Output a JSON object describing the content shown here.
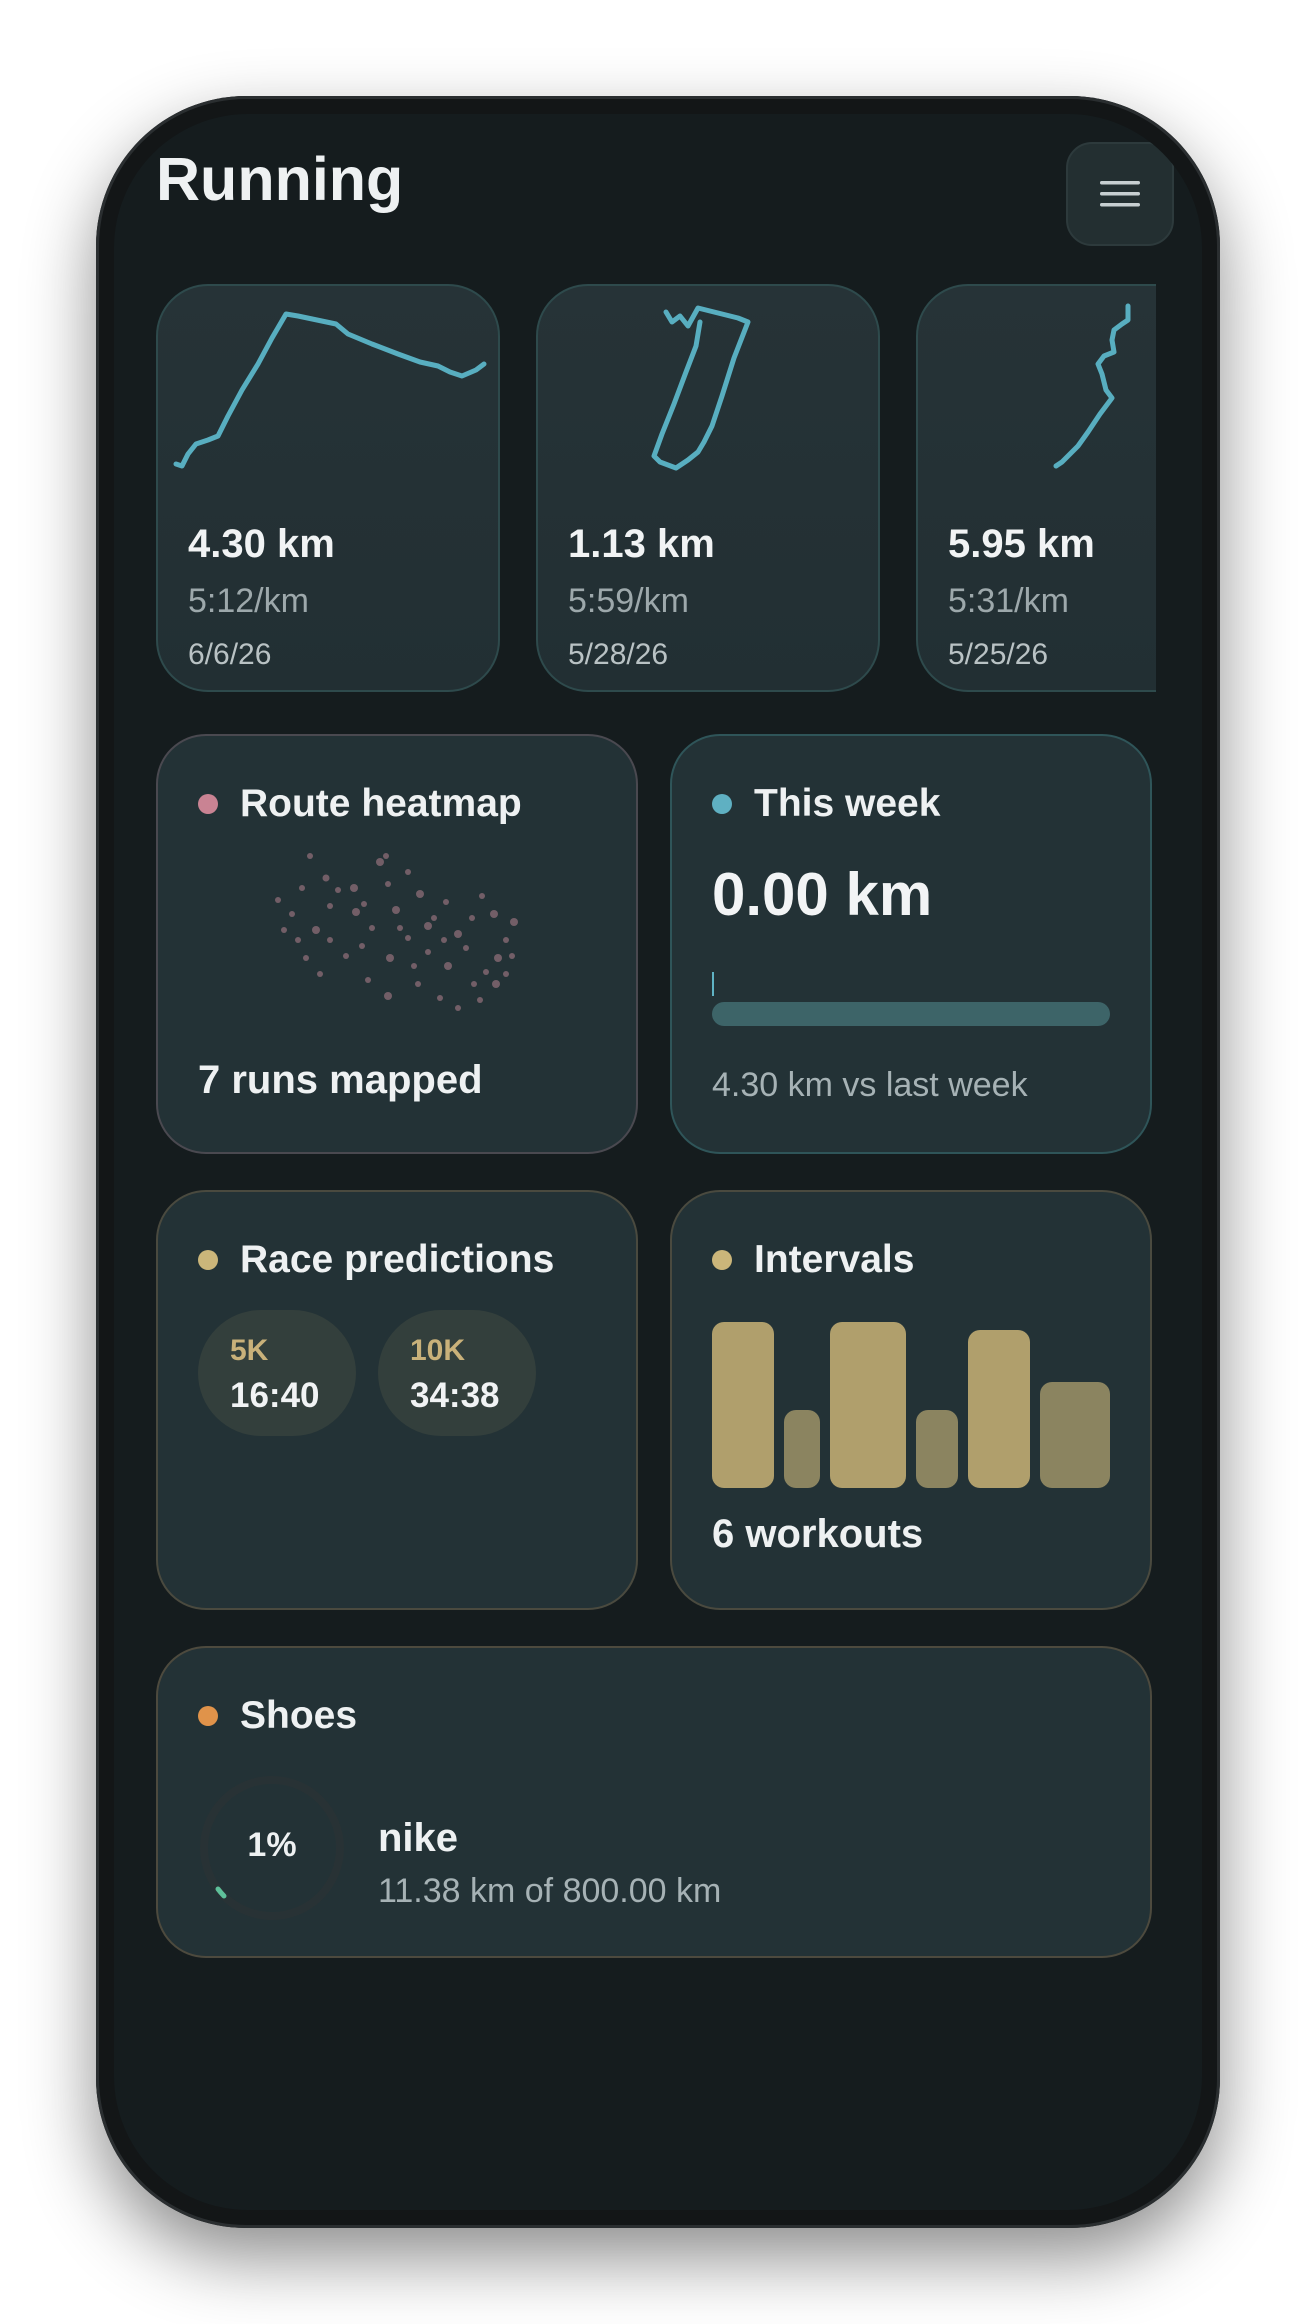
{
  "app": {
    "title": "Running"
  },
  "header": {
    "menu_icon": "hamburger-menu-icon"
  },
  "recent_runs": [
    {
      "distance": "4.30 km",
      "pace": "5:12/km",
      "date": "6/6/26"
    },
    {
      "distance": "1.13 km",
      "pace": "5:59/km",
      "date": "5/28/26"
    },
    {
      "distance": "5.95 km",
      "pace": "5:31/km",
      "date": "5/25/26"
    }
  ],
  "heatmap": {
    "title": "Route heatmap",
    "footer": "7 runs mapped",
    "dot_color": "#c98393"
  },
  "this_week": {
    "title": "This week",
    "value": "0.00 km",
    "compare": "4.30 km vs last week",
    "progress": 0.0,
    "dot_color": "#5fb0c2"
  },
  "race_predictions": {
    "title": "Race predictions",
    "dot_color": "#cbb67a",
    "items": [
      {
        "distance": "5K",
        "time": "16:40"
      },
      {
        "distance": "10K",
        "time": "34:38"
      }
    ]
  },
  "intervals": {
    "title": "Intervals",
    "footer": "6 workouts",
    "dot_color": "#cbb67a"
  },
  "shoes": {
    "title": "Shoes",
    "dot_color": "#e0934a",
    "name": "nike",
    "usage": "11.38 km of 800.00 km",
    "percent_label": "1%",
    "fraction": 0.014
  },
  "colors": {
    "route_line": "#58aec0",
    "bar_tall": "#b09f6c",
    "bar_short": "#8b8460"
  }
}
